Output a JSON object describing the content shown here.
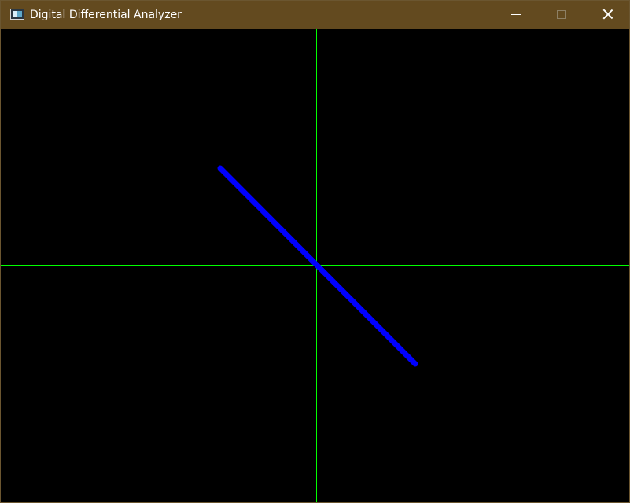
{
  "window": {
    "title": "Digital Differential Analyzer",
    "app_icon": "app-window-icon",
    "controls": {
      "minimize_icon": "minimize-icon",
      "maximize_icon": "maximize-icon",
      "close_icon": "close-icon"
    }
  },
  "canvas": {
    "background_color": "#000000",
    "axis_color": "#00ff00",
    "line_color": "#0000ff"
  }
}
